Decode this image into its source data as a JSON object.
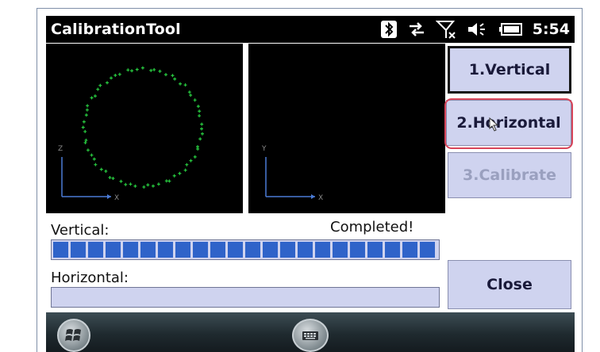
{
  "app": {
    "title": "CalibrationTool",
    "time": "5:54"
  },
  "status_icons": [
    "bluetooth-icon",
    "sync-icon",
    "signal-off-icon",
    "volume-icon",
    "battery-icon"
  ],
  "plots": {
    "vertical": {
      "axis_up": "Z",
      "axis_right": "X"
    },
    "horizontal": {
      "axis_up": "Y",
      "axis_right": "X"
    }
  },
  "buttons": {
    "vertical": "1.Vertical",
    "horizontal": "2.Horizontal",
    "calibrate": "3.Calibrate",
    "close": "Close"
  },
  "progress": {
    "vertical_label": "Vertical:",
    "vertical_status": "Completed!",
    "vertical_percent": 100,
    "horizontal_label": "Horizontal:",
    "horizontal_percent": 0
  },
  "taskbar": {
    "start": "start-icon",
    "keyboard": "keyboard-icon"
  },
  "colors": {
    "plot_bg": "#000000",
    "points": "#27c93f",
    "progress_fill": "#2f63c9",
    "button_bg": "#cfd3ef",
    "highlight": "#d8455a"
  }
}
